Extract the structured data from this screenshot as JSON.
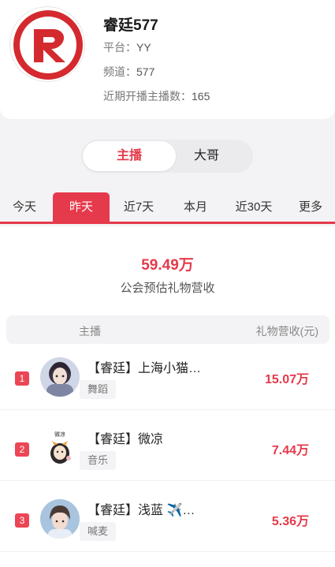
{
  "guild": {
    "name": "睿廷577",
    "platform_label": "平台：",
    "platform": "YY",
    "channel_label": "频道：",
    "channel": "577",
    "streamers_label": "近期开播主播数：",
    "streamers": "165",
    "logo_color": "#d42a2f"
  },
  "segment": {
    "active": "主播",
    "inactive": "大哥"
  },
  "tabs": [
    "今天",
    "昨天",
    "近7天",
    "本月",
    "近30天",
    "更多"
  ],
  "active_tab": "昨天",
  "summary": {
    "total": "59.49万",
    "label": "公会预估礼物营收"
  },
  "table": {
    "col_streamer": "主播",
    "col_revenue": "礼物营收(元)",
    "rows": [
      {
        "rank": "1",
        "name": "【睿廷】上海小猫…",
        "tag": "舞蹈",
        "amount": "15.07万"
      },
      {
        "rank": "2",
        "name": "【睿廷】微凉",
        "tag": "音乐",
        "amount": "7.44万"
      },
      {
        "rank": "3",
        "name": "【睿廷】浅蓝 ✈️…",
        "tag": "喊麦",
        "amount": "5.36万"
      }
    ]
  },
  "avatar2_text": "微凉",
  "colors": {
    "accent": "#e53a4b",
    "background": "#f3f3f5"
  }
}
